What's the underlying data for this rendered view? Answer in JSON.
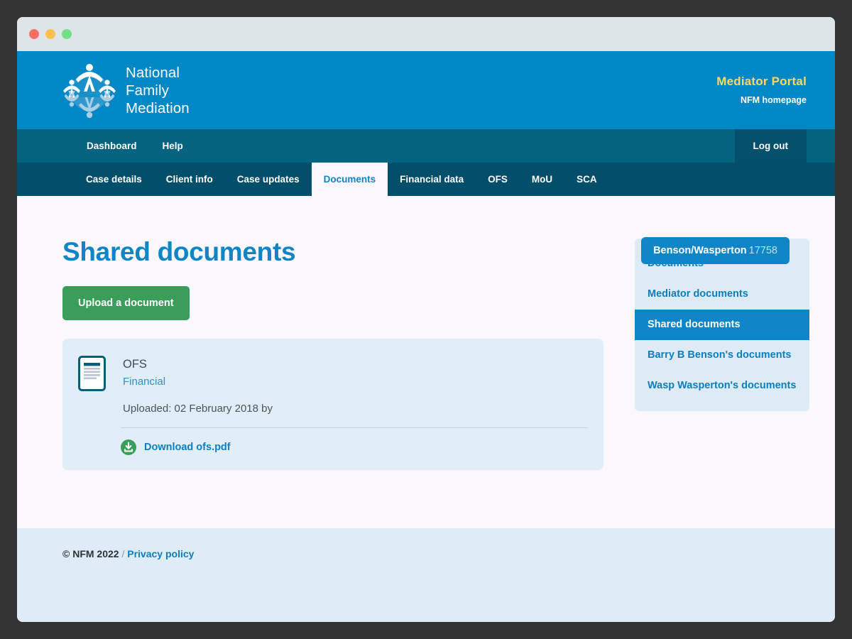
{
  "window": {
    "traffic_lights": [
      "close",
      "minimize",
      "maximize"
    ]
  },
  "header": {
    "logo_icon": "nfm-circle-of-people-logo",
    "brand_line_1": "National",
    "brand_line_2": "Family",
    "brand_line_3": "Mediation",
    "portal_title": "Mediator Portal",
    "homepage_link": "NFM homepage",
    "colors": {
      "brand_blue": "#0087c5",
      "portal_gold": "#ffd964"
    }
  },
  "nav_primary": {
    "items": [
      {
        "label": "Dashboard"
      },
      {
        "label": "Help"
      }
    ],
    "logout_label": "Log out"
  },
  "nav_tabs": {
    "items": [
      {
        "label": "Case details",
        "active": false
      },
      {
        "label": "Client info",
        "active": false
      },
      {
        "label": "Case updates",
        "active": false
      },
      {
        "label": "Documents",
        "active": true
      },
      {
        "label": "Financial data",
        "active": false
      },
      {
        "label": "OFS",
        "active": false
      },
      {
        "label": "MoU",
        "active": false
      },
      {
        "label": "SCA",
        "active": false
      }
    ]
  },
  "main": {
    "page_title": "Shared documents",
    "upload_button": "Upload a document",
    "case_badge": {
      "name": "Benson/Wasperton",
      "number": "17758"
    },
    "documents": [
      {
        "icon": "document-file-icon",
        "name": "OFS",
        "category": "Financial",
        "uploaded": "Uploaded: 02 February 2018 by",
        "download_icon": "download-circle-icon",
        "download_label": "Download ofs.pdf"
      }
    ]
  },
  "side_nav": {
    "items": [
      {
        "label": "Documents",
        "active": false
      },
      {
        "label": "Mediator documents",
        "active": false
      },
      {
        "label": "Shared documents",
        "active": true
      },
      {
        "label": "Barry B Benson's documents",
        "active": false
      },
      {
        "label": "Wasp Wasperton's documents",
        "active": false
      }
    ]
  },
  "footer": {
    "copyright": "© NFM 2022",
    "separator": "/",
    "privacy_link": "Privacy policy"
  }
}
